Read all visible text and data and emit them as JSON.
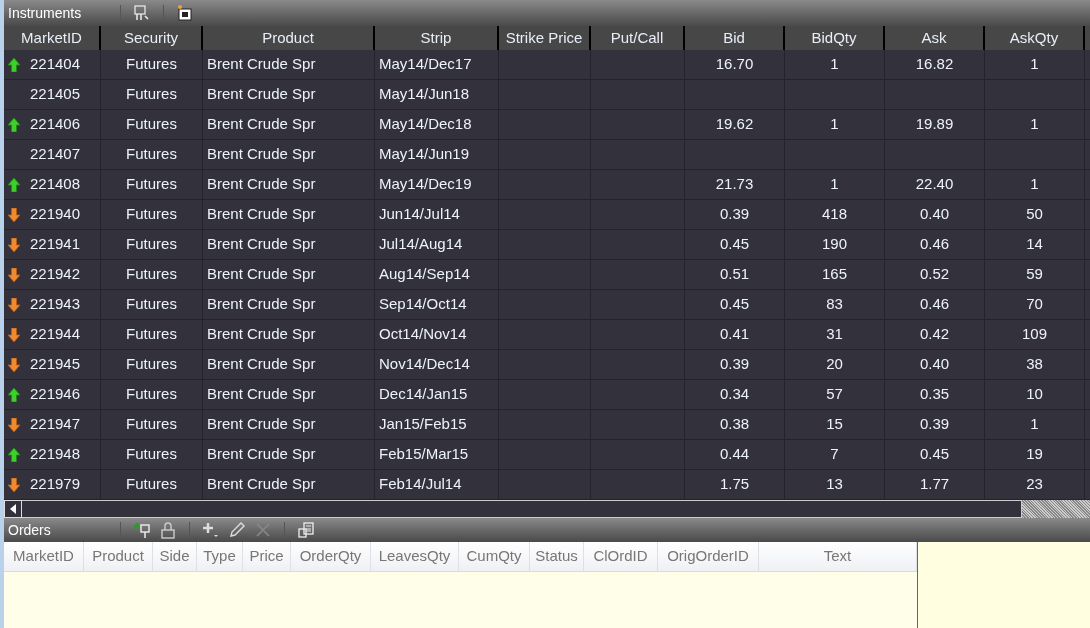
{
  "instruments": {
    "title": "Instruments",
    "columns": [
      "MarketID",
      "Security",
      "Product",
      "Strip",
      "Strike Price",
      "Put/Call",
      "Bid",
      "BidQty",
      "Ask",
      "AskQty"
    ],
    "rows": [
      {
        "kind": "up",
        "cells": [
          "221404",
          "Futures",
          "Brent Crude Spr",
          "May14/Dec17",
          "",
          "",
          "16.70",
          "1",
          "16.82",
          "1"
        ]
      },
      {
        "kind": "plain",
        "cells": [
          "221405",
          "Futures",
          "Brent Crude Spr",
          "May14/Jun18",
          "",
          "",
          "",
          "",
          "",
          ""
        ]
      },
      {
        "kind": "up",
        "cells": [
          "221406",
          "Futures",
          "Brent Crude Spr",
          "May14/Dec18",
          "",
          "",
          "19.62",
          "1",
          "19.89",
          "1"
        ]
      },
      {
        "kind": "plain",
        "cells": [
          "221407",
          "Futures",
          "Brent Crude Spr",
          "May14/Jun19",
          "",
          "",
          "",
          "",
          "",
          ""
        ]
      },
      {
        "kind": "up",
        "cells": [
          "221408",
          "Futures",
          "Brent Crude Spr",
          "May14/Dec19",
          "",
          "",
          "21.73",
          "1",
          "22.40",
          "1"
        ]
      },
      {
        "kind": "down",
        "cells": [
          "221940",
          "Futures",
          "Brent Crude Spr",
          "Jun14/Jul14",
          "",
          "",
          "0.39",
          "418",
          "0.40",
          "50"
        ]
      },
      {
        "kind": "down",
        "cells": [
          "221941",
          "Futures",
          "Brent Crude Spr",
          "Jul14/Aug14",
          "",
          "",
          "0.45",
          "190",
          "0.46",
          "14"
        ]
      },
      {
        "kind": "down",
        "cells": [
          "221942",
          "Futures",
          "Brent Crude Spr",
          "Aug14/Sep14",
          "",
          "",
          "0.51",
          "165",
          "0.52",
          "59"
        ]
      },
      {
        "kind": "down",
        "cells": [
          "221943",
          "Futures",
          "Brent Crude Spr",
          "Sep14/Oct14",
          "",
          "",
          "0.45",
          "83",
          "0.46",
          "70"
        ]
      },
      {
        "kind": "down",
        "cells": [
          "221944",
          "Futures",
          "Brent Crude Spr",
          "Oct14/Nov14",
          "",
          "",
          "0.41",
          "31",
          "0.42",
          "109"
        ]
      },
      {
        "kind": "down",
        "cells": [
          "221945",
          "Futures",
          "Brent Crude Spr",
          "Nov14/Dec14",
          "",
          "",
          "0.39",
          "20",
          "0.40",
          "38"
        ]
      },
      {
        "kind": "up",
        "cells": [
          "221946",
          "Futures",
          "Brent Crude Spr",
          "Dec14/Jan15",
          "",
          "",
          "0.34",
          "57",
          "0.35",
          "10"
        ]
      },
      {
        "kind": "down",
        "cells": [
          "221947",
          "Futures",
          "Brent Crude Spr",
          "Jan15/Feb15",
          "",
          "",
          "0.38",
          "15",
          "0.39",
          "1"
        ]
      },
      {
        "kind": "up",
        "cells": [
          "221948",
          "Futures",
          "Brent Crude Spr",
          "Feb15/Mar15",
          "",
          "",
          "0.44",
          "7",
          "0.45",
          "19"
        ]
      },
      {
        "kind": "down",
        "cells": [
          "221979",
          "Futures",
          "Brent Crude Spr",
          "Feb14/Jul14",
          "",
          "",
          "1.75",
          "13",
          "1.77",
          "23"
        ]
      }
    ]
  },
  "orders": {
    "title": "Orders",
    "columns": [
      "MarketID",
      "Product",
      "Side",
      "Type",
      "Price",
      "OrderQty",
      "LeavesQty",
      "CumQty",
      "Status",
      "ClOrdID",
      "OrigOrderID",
      "Text"
    ]
  }
}
